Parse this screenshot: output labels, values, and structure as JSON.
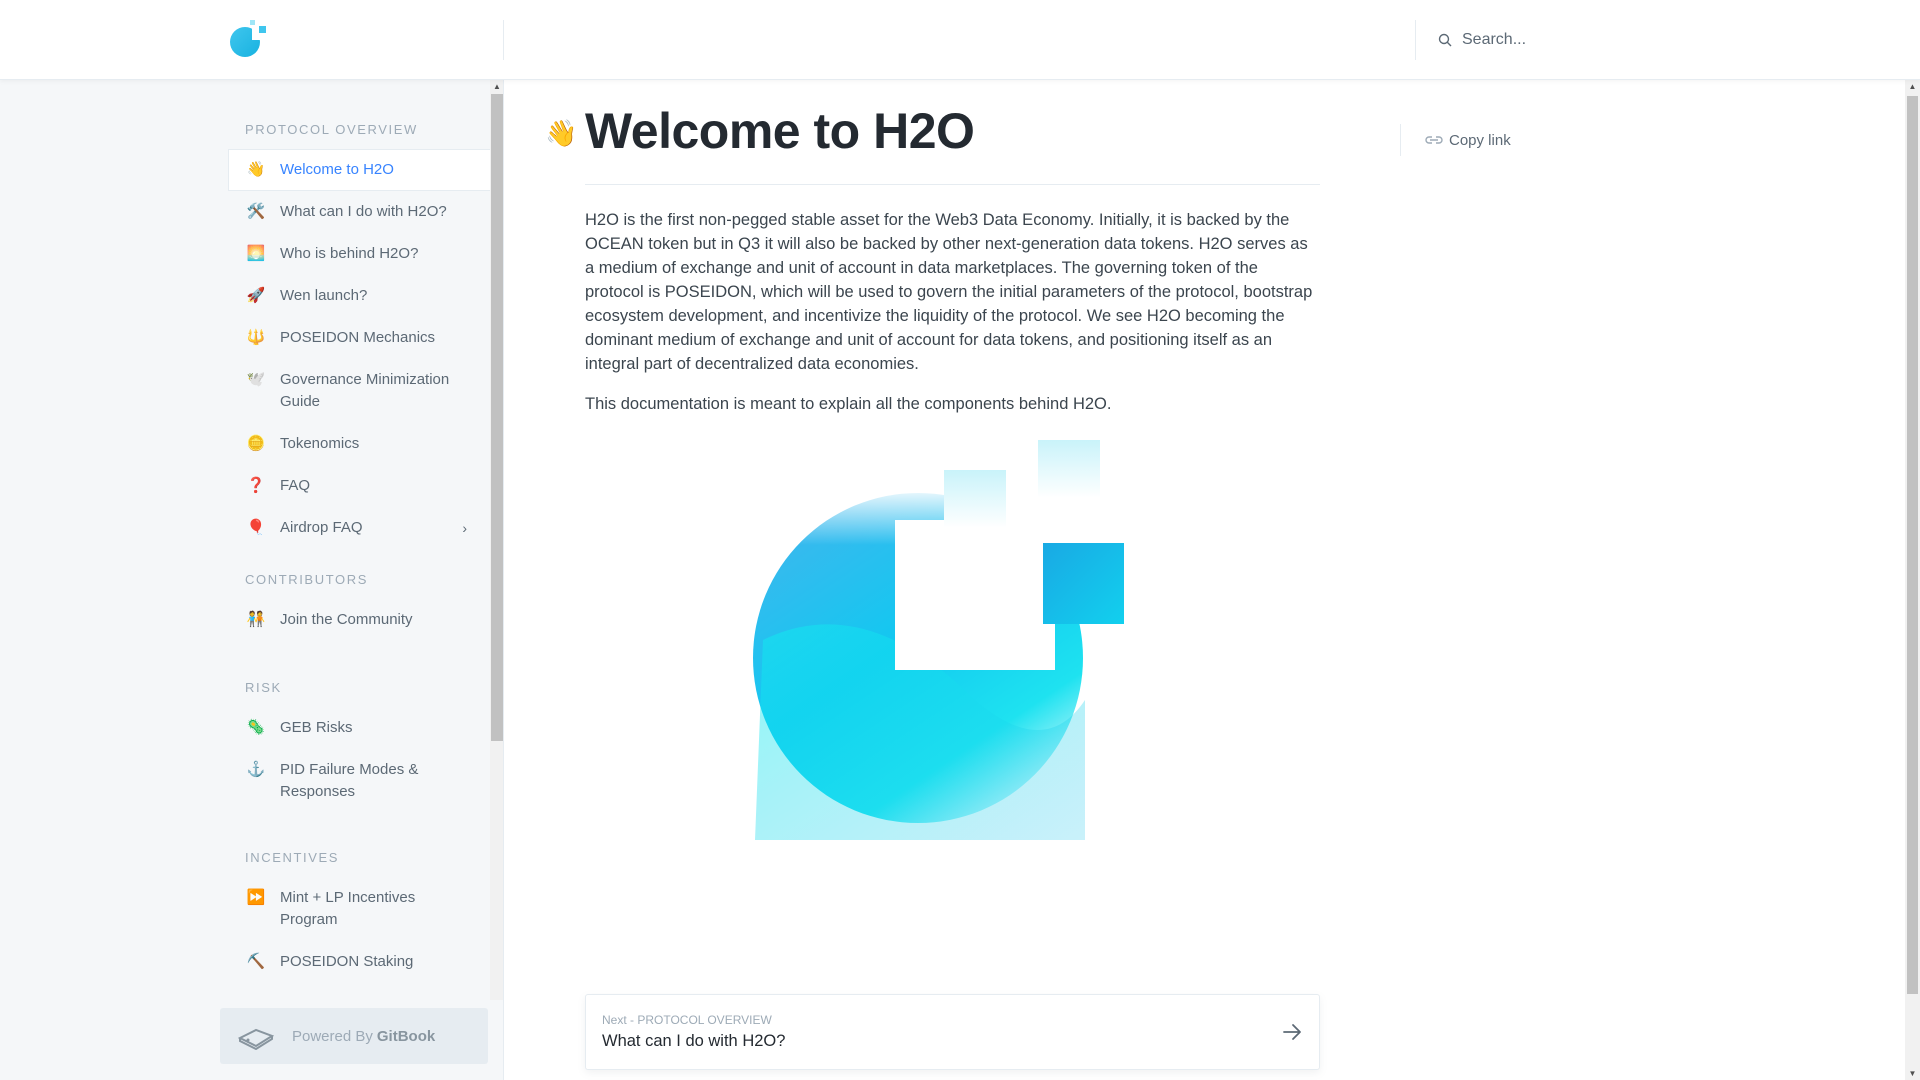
{
  "header": {
    "logo_name": "h2o-logo",
    "search_placeholder": "Search..."
  },
  "sidebar": {
    "sections": [
      {
        "title": "PROTOCOL OVERVIEW",
        "items": [
          {
            "emoji": "👋",
            "label": "Welcome to H2O",
            "active": true
          },
          {
            "emoji": "🛠️",
            "label": "What can I do with H2O?"
          },
          {
            "emoji": "🌅",
            "label": "Who is behind H2O?"
          },
          {
            "emoji": "🚀",
            "label": "Wen launch?"
          },
          {
            "emoji": "🔱",
            "label": "POSEIDON Mechanics"
          },
          {
            "emoji": "🕊️",
            "label": "Governance Minimization Guide"
          },
          {
            "emoji": "🪙",
            "label": "Tokenomics"
          },
          {
            "emoji": "❓",
            "label": "FAQ"
          },
          {
            "emoji": "🎈",
            "label": "Airdrop FAQ",
            "has_children": true
          }
        ]
      },
      {
        "title": "CONTRIBUTORS",
        "items": [
          {
            "emoji": "🧑‍🤝‍🧑",
            "label": "Join the Community"
          }
        ]
      },
      {
        "title": "RISK",
        "items": [
          {
            "emoji": "🦠",
            "label": "GEB Risks"
          },
          {
            "emoji": "⚓",
            "label": "PID Failure Modes & Responses"
          }
        ]
      },
      {
        "title": "INCENTIVES",
        "items": [
          {
            "emoji": "⏩",
            "label": "Mint + LP Incentives Program"
          },
          {
            "emoji": "⛏️",
            "label": "POSEIDON Staking"
          }
        ]
      }
    ],
    "chevron": "›",
    "powered_prefix": "Powered By",
    "powered_brand": "GitBook"
  },
  "main": {
    "title_emoji": "👋",
    "title": "Welcome to H2O",
    "paragraphs": [
      "H2O is the first non-pegged stable asset for the Web3 Data Economy. Initially, it is backed by the OCEAN token but in Q3 it will also be backed by other next-generation data tokens. H2O serves as a medium of exchange and unit of account in data marketplaces. The governing token of the protocol is POSEIDON, which will be used to govern the initial parameters of the protocol, bootstrap ecosystem development, and incentivize the liquidity of the protocol. We see H2O becoming the dominant medium of exchange and unit of account for data tokens, and positioning itself as an integral part of decentralized data economies.",
      "This documentation is meant to explain all the components behind H2O."
    ],
    "copy_link": "Copy link",
    "next": {
      "small": "Next - PROTOCOL OVERVIEW",
      "title": "What can I do with H2O?"
    }
  },
  "colors": {
    "accent": "#3884ff",
    "sidebar_bg": "#f5f7f9",
    "text": "#3b454e",
    "muted": "#9daab6",
    "logo_cyan": "#1fd3f0"
  }
}
